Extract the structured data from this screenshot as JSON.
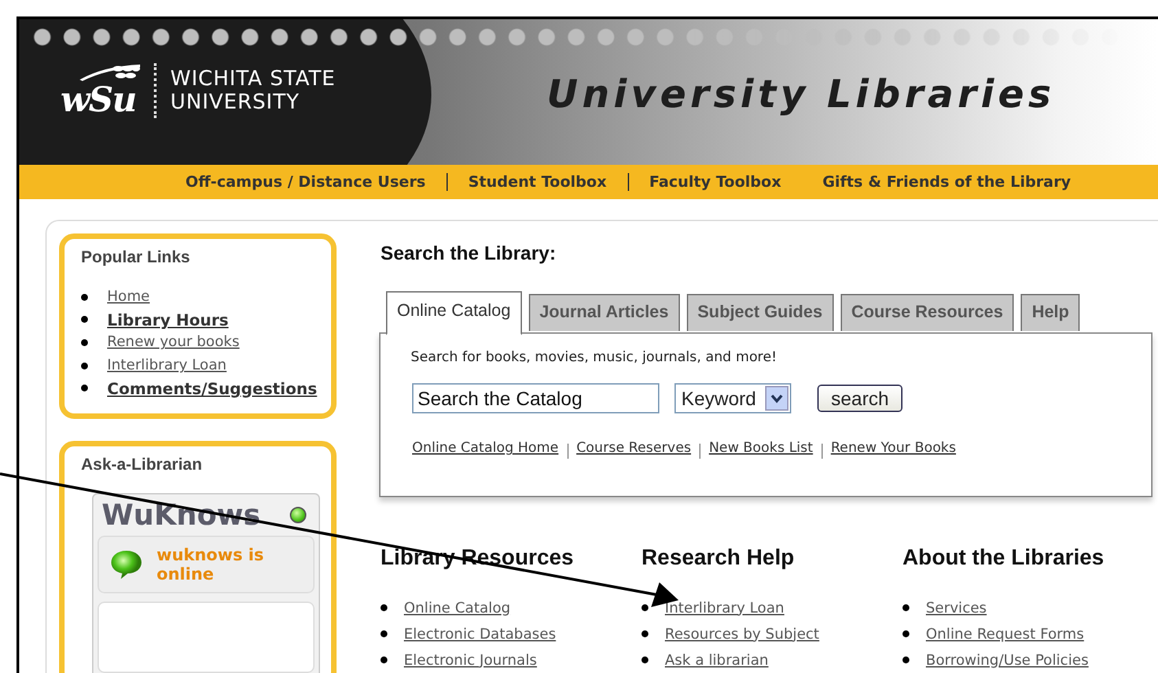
{
  "header": {
    "logo_text": "wSu",
    "name_line1": "WICHITA STATE",
    "name_line2": "UNIVERSITY",
    "title": "University Libraries"
  },
  "nav": [
    "Off-campus / Distance Users",
    "Student Toolbox",
    "Faculty Toolbox",
    "Gifts & Friends of the Library"
  ],
  "popular_links": {
    "title": "Popular Links",
    "items": [
      {
        "label": "Home",
        "emphasized": false
      },
      {
        "label": "Library Hours",
        "emphasized": true
      },
      {
        "label": "Renew your books",
        "emphasized": false
      },
      {
        "label": "Interlibrary Loan",
        "emphasized": false
      },
      {
        "label": "Comments/Suggestions",
        "emphasized": true
      }
    ]
  },
  "ask": {
    "title": "Ask-a-Librarian",
    "widget": {
      "title": "WuKnows",
      "status": "wuknows is online",
      "online": true
    }
  },
  "search": {
    "title": "Search the Library:",
    "tabs": [
      {
        "label": "Online Catalog",
        "selected": true
      },
      {
        "label": "Journal Articles",
        "selected": false
      },
      {
        "label": "Subject Guides",
        "selected": false
      },
      {
        "label": "Course Resources",
        "selected": false
      },
      {
        "label": "Help",
        "selected": false
      }
    ],
    "description": "Search for books, movies, music, journals, and more!",
    "query": "Search the Catalog",
    "type": "Keyword",
    "button": "search",
    "links": [
      "Online Catalog Home",
      "Course Reserves",
      "New Books List",
      "Renew Your Books"
    ]
  },
  "columns": [
    {
      "title": "Library Resources",
      "links": [
        "Online Catalog",
        "Electronic Databases",
        "Electronic Journals"
      ]
    },
    {
      "title": "Research Help",
      "links": [
        "Interlibrary Loan",
        "Resources by Subject",
        "Ask a librarian"
      ]
    },
    {
      "title": "About the Libraries",
      "links": [
        "Services",
        "Online Request Forms",
        "Borrowing/Use Policies"
      ]
    }
  ]
}
